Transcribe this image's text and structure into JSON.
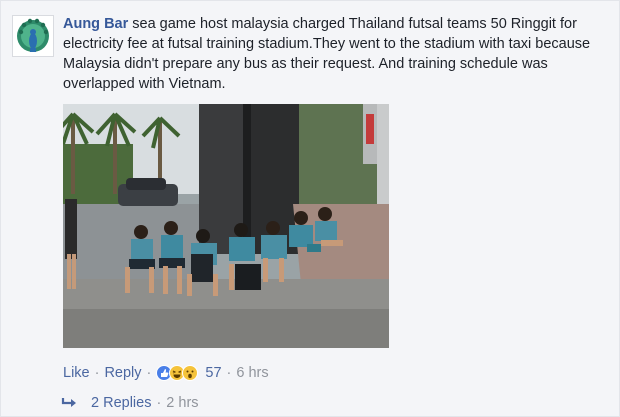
{
  "comment": {
    "author": "Aung Bar",
    "text": "sea game host malaysia charged Thailand futsal teams 50 Ringgit for electricity fee at futsal training stadium.They went to the stadium with taxi because Malaysia didn't prepare any bus as their request. And training schedule was overlapped with Vietnam."
  },
  "avatar": {
    "icon": "peacock-icon"
  },
  "photo": {
    "description_icon": "photo"
  },
  "actions": {
    "like": "Like",
    "reply": "Reply",
    "reactions": [
      "like-reaction-icon",
      "haha-reaction-icon",
      "wow-reaction-icon"
    ],
    "reaction_count": "57",
    "time": "6 hrs"
  },
  "replies": {
    "label": "2 Replies",
    "time": "2 hrs"
  },
  "colors": {
    "link": "#4b67a1",
    "author": "#365899",
    "meta": "#90949c"
  }
}
